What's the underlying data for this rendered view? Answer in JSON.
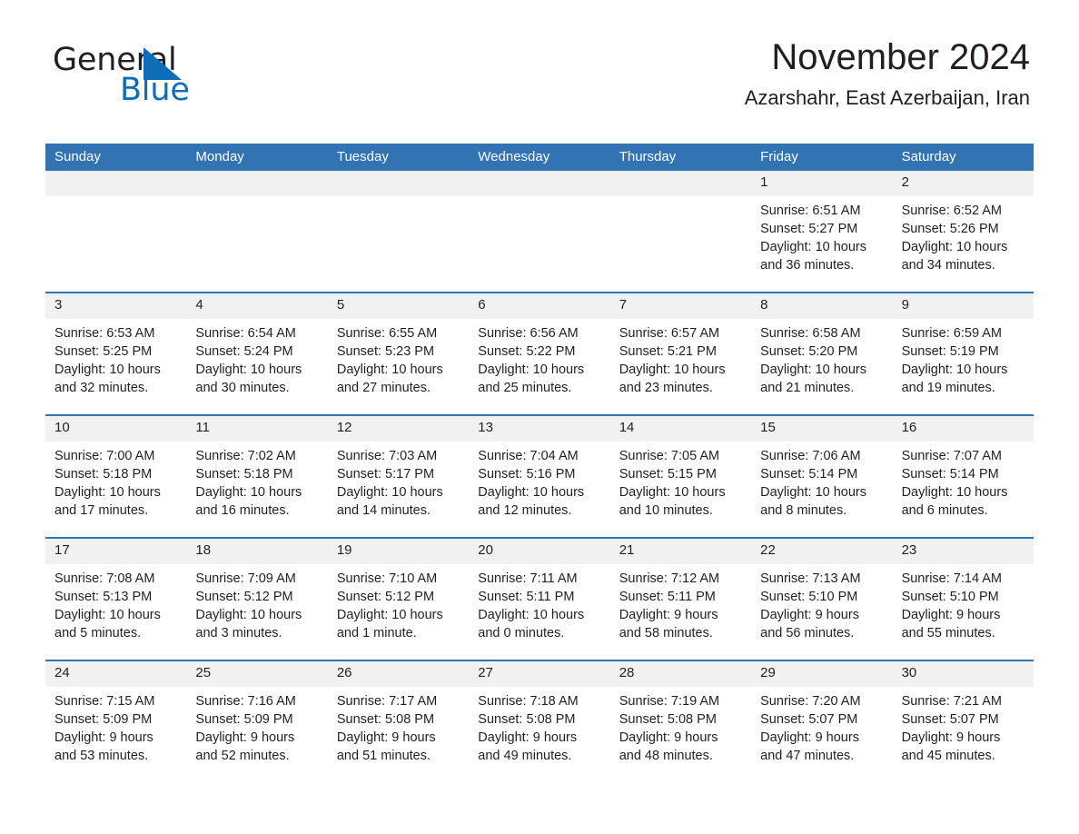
{
  "brand": {
    "name_dark": "General",
    "name_blue": "Blue",
    "triangle_color": "#0f6cb6",
    "blue_color": "#0f6cb6"
  },
  "header": {
    "title": "November 2024",
    "subtitle": "Azarshahr, East Azerbaijan, Iran"
  },
  "theme": {
    "header_bg": "#3273b4",
    "header_text": "#ffffff",
    "daynum_band_bg": "#f1f1f1",
    "cell_bg": "#ffffff",
    "text": "#231f20",
    "week_separator": "#3273b4"
  },
  "weekdays": [
    "Sunday",
    "Monday",
    "Tuesday",
    "Wednesday",
    "Thursday",
    "Friday",
    "Saturday"
  ],
  "weeks": [
    [
      {
        "day": "",
        "empty": true
      },
      {
        "day": "",
        "empty": true
      },
      {
        "day": "",
        "empty": true
      },
      {
        "day": "",
        "empty": true
      },
      {
        "day": "",
        "empty": true
      },
      {
        "day": "1",
        "sunrise": "Sunrise: 6:51 AM",
        "sunset": "Sunset: 5:27 PM",
        "daylight1": "Daylight: 10 hours",
        "daylight2": "and 36 minutes."
      },
      {
        "day": "2",
        "sunrise": "Sunrise: 6:52 AM",
        "sunset": "Sunset: 5:26 PM",
        "daylight1": "Daylight: 10 hours",
        "daylight2": "and 34 minutes."
      }
    ],
    [
      {
        "day": "3",
        "sunrise": "Sunrise: 6:53 AM",
        "sunset": "Sunset: 5:25 PM",
        "daylight1": "Daylight: 10 hours",
        "daylight2": "and 32 minutes."
      },
      {
        "day": "4",
        "sunrise": "Sunrise: 6:54 AM",
        "sunset": "Sunset: 5:24 PM",
        "daylight1": "Daylight: 10 hours",
        "daylight2": "and 30 minutes."
      },
      {
        "day": "5",
        "sunrise": "Sunrise: 6:55 AM",
        "sunset": "Sunset: 5:23 PM",
        "daylight1": "Daylight: 10 hours",
        "daylight2": "and 27 minutes."
      },
      {
        "day": "6",
        "sunrise": "Sunrise: 6:56 AM",
        "sunset": "Sunset: 5:22 PM",
        "daylight1": "Daylight: 10 hours",
        "daylight2": "and 25 minutes."
      },
      {
        "day": "7",
        "sunrise": "Sunrise: 6:57 AM",
        "sunset": "Sunset: 5:21 PM",
        "daylight1": "Daylight: 10 hours",
        "daylight2": "and 23 minutes."
      },
      {
        "day": "8",
        "sunrise": "Sunrise: 6:58 AM",
        "sunset": "Sunset: 5:20 PM",
        "daylight1": "Daylight: 10 hours",
        "daylight2": "and 21 minutes."
      },
      {
        "day": "9",
        "sunrise": "Sunrise: 6:59 AM",
        "sunset": "Sunset: 5:19 PM",
        "daylight1": "Daylight: 10 hours",
        "daylight2": "and 19 minutes."
      }
    ],
    [
      {
        "day": "10",
        "sunrise": "Sunrise: 7:00 AM",
        "sunset": "Sunset: 5:18 PM",
        "daylight1": "Daylight: 10 hours",
        "daylight2": "and 17 minutes."
      },
      {
        "day": "11",
        "sunrise": "Sunrise: 7:02 AM",
        "sunset": "Sunset: 5:18 PM",
        "daylight1": "Daylight: 10 hours",
        "daylight2": "and 16 minutes."
      },
      {
        "day": "12",
        "sunrise": "Sunrise: 7:03 AM",
        "sunset": "Sunset: 5:17 PM",
        "daylight1": "Daylight: 10 hours",
        "daylight2": "and 14 minutes."
      },
      {
        "day": "13",
        "sunrise": "Sunrise: 7:04 AM",
        "sunset": "Sunset: 5:16 PM",
        "daylight1": "Daylight: 10 hours",
        "daylight2": "and 12 minutes."
      },
      {
        "day": "14",
        "sunrise": "Sunrise: 7:05 AM",
        "sunset": "Sunset: 5:15 PM",
        "daylight1": "Daylight: 10 hours",
        "daylight2": "and 10 minutes."
      },
      {
        "day": "15",
        "sunrise": "Sunrise: 7:06 AM",
        "sunset": "Sunset: 5:14 PM",
        "daylight1": "Daylight: 10 hours",
        "daylight2": "and 8 minutes."
      },
      {
        "day": "16",
        "sunrise": "Sunrise: 7:07 AM",
        "sunset": "Sunset: 5:14 PM",
        "daylight1": "Daylight: 10 hours",
        "daylight2": "and 6 minutes."
      }
    ],
    [
      {
        "day": "17",
        "sunrise": "Sunrise: 7:08 AM",
        "sunset": "Sunset: 5:13 PM",
        "daylight1": "Daylight: 10 hours",
        "daylight2": "and 5 minutes."
      },
      {
        "day": "18",
        "sunrise": "Sunrise: 7:09 AM",
        "sunset": "Sunset: 5:12 PM",
        "daylight1": "Daylight: 10 hours",
        "daylight2": "and 3 minutes."
      },
      {
        "day": "19",
        "sunrise": "Sunrise: 7:10 AM",
        "sunset": "Sunset: 5:12 PM",
        "daylight1": "Daylight: 10 hours",
        "daylight2": "and 1 minute."
      },
      {
        "day": "20",
        "sunrise": "Sunrise: 7:11 AM",
        "sunset": "Sunset: 5:11 PM",
        "daylight1": "Daylight: 10 hours",
        "daylight2": "and 0 minutes."
      },
      {
        "day": "21",
        "sunrise": "Sunrise: 7:12 AM",
        "sunset": "Sunset: 5:11 PM",
        "daylight1": "Daylight: 9 hours",
        "daylight2": "and 58 minutes."
      },
      {
        "day": "22",
        "sunrise": "Sunrise: 7:13 AM",
        "sunset": "Sunset: 5:10 PM",
        "daylight1": "Daylight: 9 hours",
        "daylight2": "and 56 minutes."
      },
      {
        "day": "23",
        "sunrise": "Sunrise: 7:14 AM",
        "sunset": "Sunset: 5:10 PM",
        "daylight1": "Daylight: 9 hours",
        "daylight2": "and 55 minutes."
      }
    ],
    [
      {
        "day": "24",
        "sunrise": "Sunrise: 7:15 AM",
        "sunset": "Sunset: 5:09 PM",
        "daylight1": "Daylight: 9 hours",
        "daylight2": "and 53 minutes."
      },
      {
        "day": "25",
        "sunrise": "Sunrise: 7:16 AM",
        "sunset": "Sunset: 5:09 PM",
        "daylight1": "Daylight: 9 hours",
        "daylight2": "and 52 minutes."
      },
      {
        "day": "26",
        "sunrise": "Sunrise: 7:17 AM",
        "sunset": "Sunset: 5:08 PM",
        "daylight1": "Daylight: 9 hours",
        "daylight2": "and 51 minutes."
      },
      {
        "day": "27",
        "sunrise": "Sunrise: 7:18 AM",
        "sunset": "Sunset: 5:08 PM",
        "daylight1": "Daylight: 9 hours",
        "daylight2": "and 49 minutes."
      },
      {
        "day": "28",
        "sunrise": "Sunrise: 7:19 AM",
        "sunset": "Sunset: 5:08 PM",
        "daylight1": "Daylight: 9 hours",
        "daylight2": "and 48 minutes."
      },
      {
        "day": "29",
        "sunrise": "Sunrise: 7:20 AM",
        "sunset": "Sunset: 5:07 PM",
        "daylight1": "Daylight: 9 hours",
        "daylight2": "and 47 minutes."
      },
      {
        "day": "30",
        "sunrise": "Sunrise: 7:21 AM",
        "sunset": "Sunset: 5:07 PM",
        "daylight1": "Daylight: 9 hours",
        "daylight2": "and 45 minutes."
      }
    ]
  ]
}
